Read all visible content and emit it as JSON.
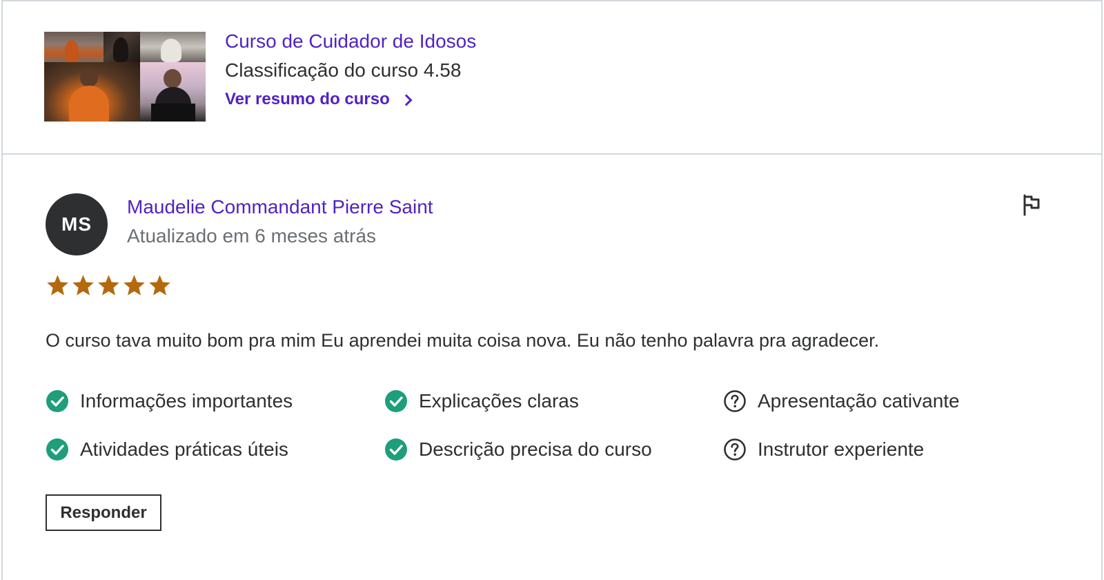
{
  "course": {
    "title": "Curso de Cuidador de Idosos",
    "rating_text": "Classificação do curso 4.58",
    "link_label": "Ver resumo do curso"
  },
  "review": {
    "avatar_initials": "MS",
    "reviewer_name": "Maudelie Commandant Pierre Saint",
    "updated": "Atualizado em 6 meses atrás",
    "rating_stars": 5,
    "text": "O curso tava muito bom pra mim Eu aprendei muita coisa nova. Eu não tenho palavra pra agradecer.",
    "criteria": [
      {
        "label": "Informações importantes",
        "status": "check"
      },
      {
        "label": "Explicações claras",
        "status": "check"
      },
      {
        "label": "Apresentação cativante",
        "status": "question"
      },
      {
        "label": "Atividades práticas úteis",
        "status": "check"
      },
      {
        "label": "Descrição precisa do curso",
        "status": "check"
      },
      {
        "label": "Instrutor experiente",
        "status": "question"
      }
    ],
    "reply_label": "Responder"
  },
  "icons": {
    "chevron": "chevron-right-icon",
    "flag": "flag-icon",
    "star": "star-icon",
    "check": "check-circle-icon",
    "question": "question-circle-icon"
  },
  "colors": {
    "accent": "#5022c3",
    "star": "#b4690e",
    "check": "#1e9e7a",
    "text": "#2d2f31",
    "muted": "#6a6f73",
    "border": "#d1d7dc"
  }
}
